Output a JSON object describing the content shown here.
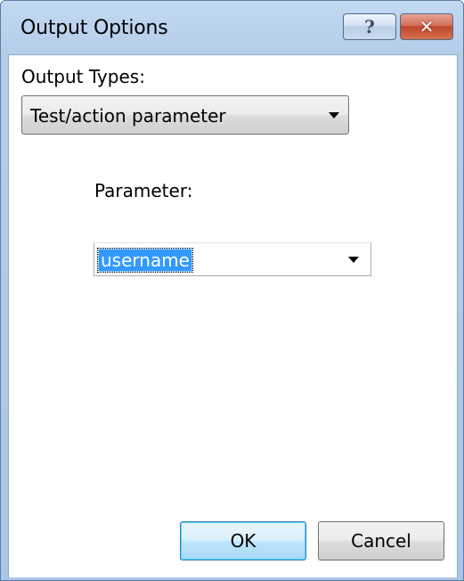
{
  "window": {
    "title": "Output Options",
    "help_icon": "question-mark-icon",
    "close_icon": "close-x-icon",
    "help_glyph": "?",
    "close_glyph": "✕"
  },
  "output_types": {
    "label": "Output Types:",
    "selected_value": "Test/action parameter",
    "dropdown_icon": "chevron-down-icon"
  },
  "parameter": {
    "label": "Parameter:",
    "selected_value": "username",
    "dropdown_icon": "chevron-down-icon"
  },
  "buttons": {
    "ok_label": "OK",
    "cancel_label": "Cancel"
  },
  "colors": {
    "selection_highlight": "#3399ff",
    "close_button": "#c7482e",
    "title_bar": "#b9d1ea"
  }
}
